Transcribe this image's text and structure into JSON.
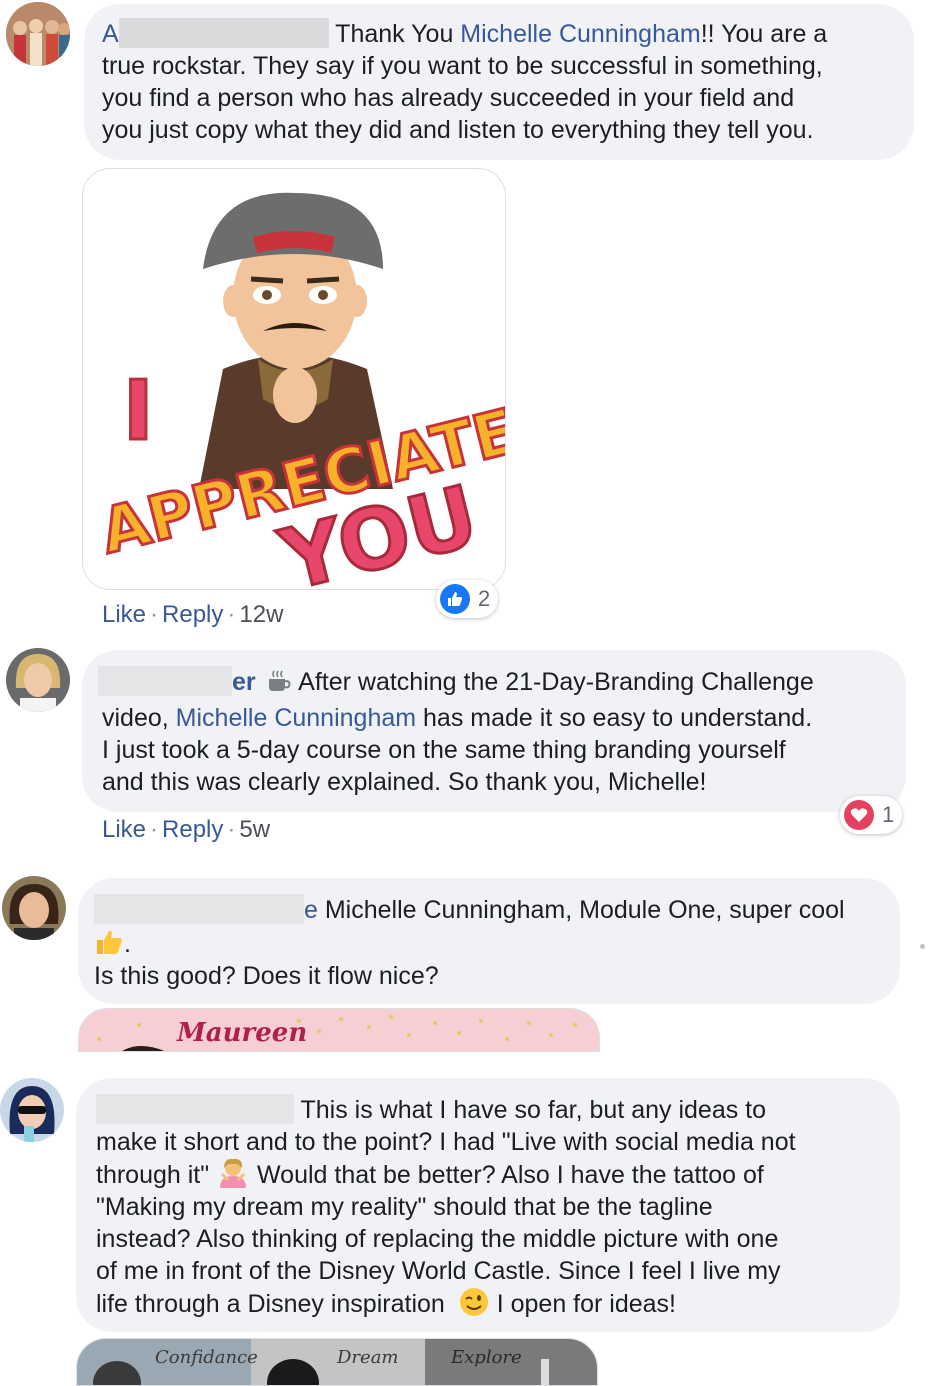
{
  "comments": [
    {
      "text_after_name": " Thank You ",
      "mention": "Michelle Cunningham",
      "text_tail": "!! You are a",
      "lines": [
        "true rockstar. They say if you want to be successful in something,",
        "you find a person who has already succeeded in your field and",
        "you just copy what they did and listen to everything they tell you."
      ],
      "sticker_text_1": "I",
      "sticker_text_2": "APPRECIATE",
      "sticker_text_3": "YOU",
      "actions": {
        "like": "Like",
        "reply": "Reply",
        "time": "12w"
      },
      "reaction": {
        "type": "like",
        "count": "2"
      }
    },
    {
      "name_tail": "er",
      "line1": " After watching the 21-Day-Branding Challenge",
      "line2_prefix": "video, ",
      "mention": "Michelle Cunningham",
      "line2_suffix": " has made it so easy to understand.",
      "lines": [
        "I just took a 5-day course on the same thing branding yourself",
        "and this was clearly explained. So thank you, Michelle!"
      ],
      "actions": {
        "like": "Like",
        "reply": "Reply",
        "time": "5w"
      },
      "reaction": {
        "type": "love",
        "count": "1"
      }
    },
    {
      "line1": " Michelle Cunningham, Module One, super cool",
      "line2": ".",
      "line3": "Is this good? Does it flow nice?",
      "image_text": "Maureen"
    },
    {
      "line1": " This is what I have so far, but any ideas to",
      "lines": [
        "make it short and to the point? I had \"Live with social media not",
        "through it\"",
        " Would that be better? Also I have the tattoo of",
        "\"Making my dream my reality\" should that be the tagline",
        "instead? Also thinking of replacing the middle picture with one",
        "of me in front of the Disney World Castle. Since I feel I live my",
        "life through a Disney inspiration",
        " I open for ideas!"
      ],
      "image_labels": [
        "Confidance",
        "Dream",
        "Explore"
      ]
    }
  ],
  "colors": {
    "link": "#385898",
    "bubble": "#f0f2f5",
    "like_blue": "#1877f2",
    "love_red": "#e4405f"
  }
}
